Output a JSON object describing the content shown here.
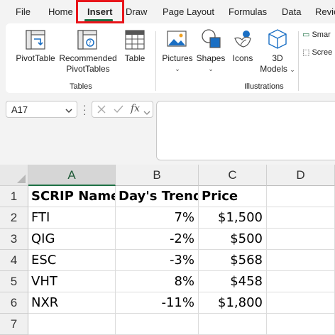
{
  "tabs": [
    "File",
    "Home",
    "Insert",
    "Draw",
    "Page Layout",
    "Formulas",
    "Data",
    "Revie"
  ],
  "active_tab": "Insert",
  "ribbon": {
    "tables": {
      "pivot": "PivotTable",
      "recommended_1": "Recommended",
      "recommended_2": "PivotTables",
      "table": "Table",
      "group_label": "Tables"
    },
    "illustrations": {
      "pictures": "Pictures",
      "shapes": "Shapes",
      "icons": "Icons",
      "models_1": "3D",
      "models_2": "Models",
      "group_label": "Illustrations"
    },
    "smartart": "Smar",
    "screenshot": "Scree"
  },
  "formula_bar": {
    "name_box": "A17",
    "fx": "fx"
  },
  "grid": {
    "columns": [
      "A",
      "B",
      "C",
      "D"
    ],
    "selected_column": "A",
    "rows": [
      "1",
      "2",
      "3",
      "4",
      "5",
      "6",
      "7"
    ],
    "cells": [
      [
        "SCRIP Name",
        "Day's Trend",
        "Price",
        ""
      ],
      [
        "FTI",
        "7%",
        "$1,500",
        ""
      ],
      [
        "QIG",
        "-2%",
        "$500",
        ""
      ],
      [
        "ESC",
        "-3%",
        "$568",
        ""
      ],
      [
        "VHT",
        "8%",
        "$458",
        ""
      ],
      [
        "NXR",
        "-11%",
        "$1,800",
        ""
      ],
      [
        "",
        "",
        "",
        ""
      ]
    ]
  },
  "colors": {
    "accent_green": "#1e7145",
    "highlight_red": "#e8151b"
  }
}
